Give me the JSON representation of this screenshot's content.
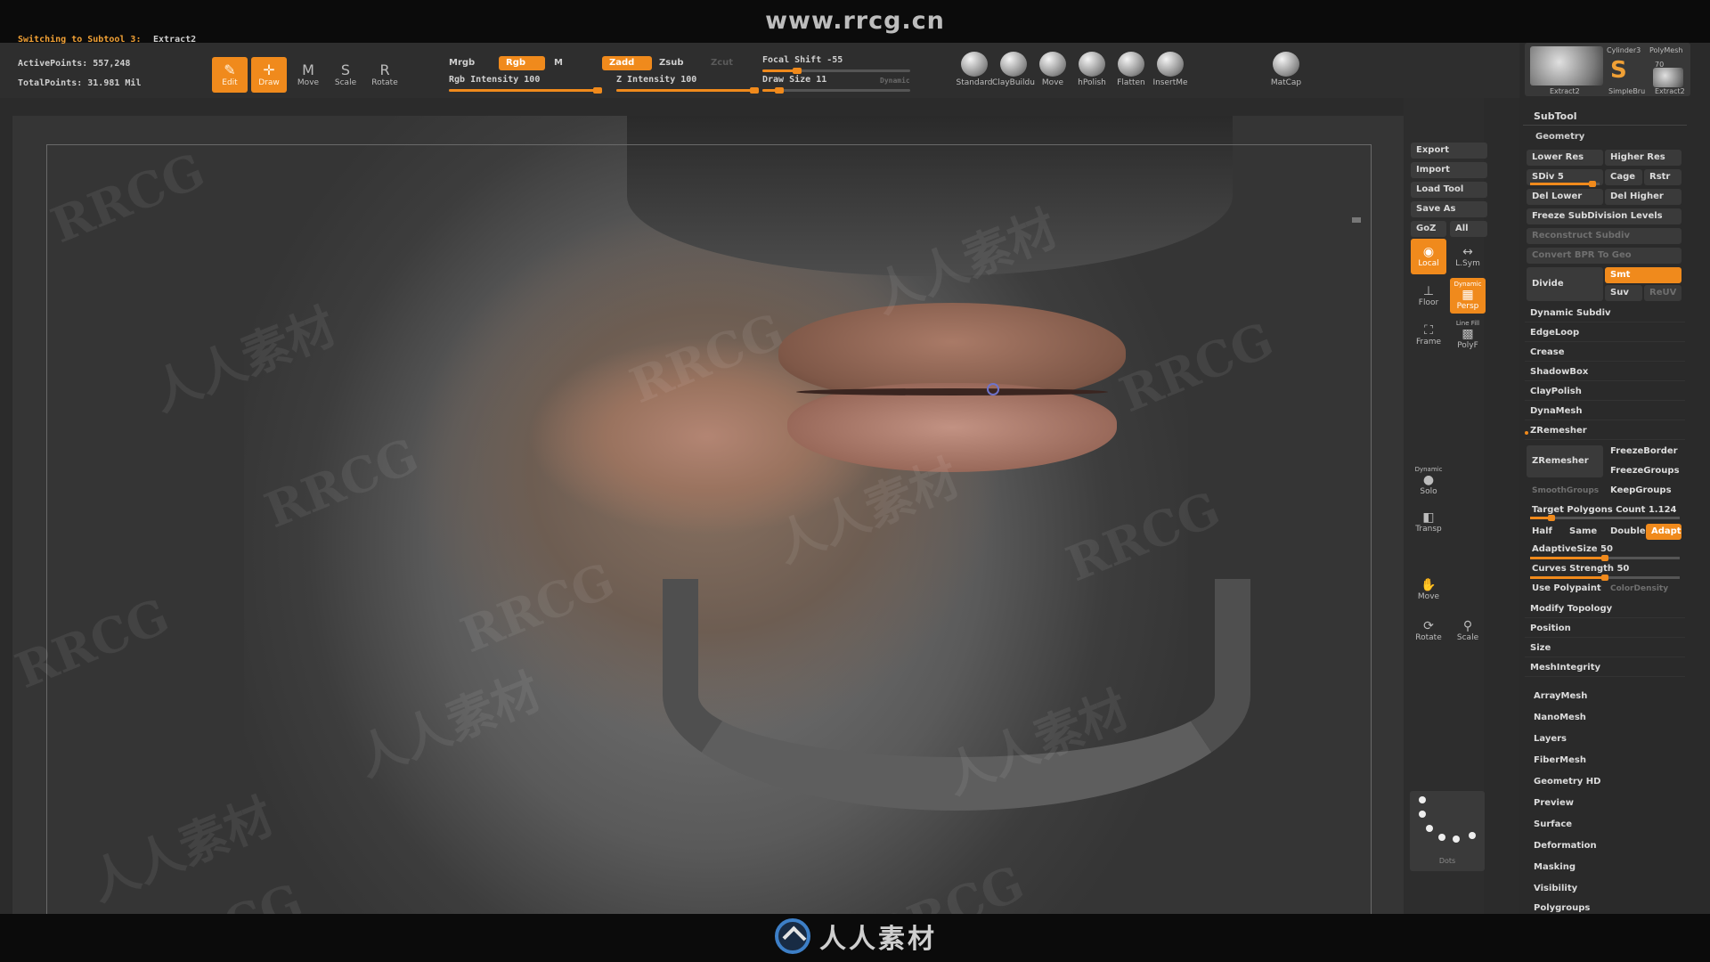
{
  "site": {
    "url": "www.rrcg.cn",
    "bottom_brand": "人人素材"
  },
  "status": {
    "switching_label": "Switching to Subtool 3:",
    "switching_value": "Extract2",
    "active_points": "ActivePoints: 557,248",
    "total_points": "TotalPoints: 31.981 Mil"
  },
  "toolbar": {
    "modes": [
      {
        "label": "Edit",
        "active": true
      },
      {
        "label": "Draw",
        "active": true
      },
      {
        "label": "Move",
        "active": false
      },
      {
        "label": "Scale",
        "active": false
      },
      {
        "label": "Rotate",
        "active": false
      }
    ],
    "mrgb": "Mrgb",
    "rgb": "Rgb",
    "m": "M",
    "zadd": "Zadd",
    "zsub": "Zsub",
    "zcut": "Zcut",
    "rgb_intensity": {
      "label": "Rgb Intensity 100",
      "value": 100
    },
    "z_intensity": {
      "label": "Z Intensity 100",
      "value": 100
    },
    "focal_shift": {
      "label": "Focal Shift -55",
      "value": -55
    },
    "draw_size": {
      "label": "Draw Size 11",
      "value": 11
    },
    "dynamic": "Dynamic",
    "brushes": [
      "Standard",
      "ClayBuildu",
      "Move",
      "hPolish",
      "Flatten",
      "InsertMe",
      "MatCap"
    ]
  },
  "shelf": {
    "buttons": [
      "Export",
      "Import",
      "Load Tool",
      "Save As"
    ],
    "goz": "GoZ",
    "all": "All",
    "tools": [
      "Local",
      "L.Sym",
      "Floor",
      "Persp",
      "Frame",
      "PolyF",
      "Solo",
      "Transp",
      "Move",
      "Rotate",
      "Scale"
    ],
    "dynamic_label": "Dynamic",
    "line_fill": "Line Fill",
    "dots": "Dots"
  },
  "palette": {
    "thumbs": [
      "Cylinder3",
      "PolyMesh",
      "Extract2",
      "SimpleBru",
      "Extract2"
    ],
    "thumb_count": "70",
    "subtool": "SubTool",
    "geometry": "Geometry",
    "lower_res": "Lower Res",
    "higher_res": "Higher Res",
    "sdiv": "SDiv 5",
    "cage": "Cage",
    "rstr": "Rstr",
    "del_lower": "Del Lower",
    "del_higher": "Del Higher",
    "freeze_subdiv": "Freeze SubDivision Levels",
    "reconstruct": "Reconstruct Subdiv",
    "convert_bpr": "Convert BPR To Geo",
    "divide": "Divide",
    "smt": "Smt",
    "suv": "Suv",
    "reuv": "ReUV",
    "rows1": [
      "Dynamic Subdiv",
      "EdgeLoop",
      "Crease",
      "ShadowBox",
      "ClayPolish",
      "DynaMesh"
    ],
    "zremesher_header": "ZRemesher",
    "zremesher_btn": "ZRemesher",
    "freeze_border": "FreezeBorder",
    "freeze_groups": "FreezeGroups",
    "smooth_groups": "SmoothGroups",
    "keep_groups": "KeepGroups",
    "target_poly": "Target Polygons Count 1.124",
    "half": "Half",
    "same": "Same",
    "double": "Double",
    "adapt": "Adapt",
    "adaptive_size": {
      "label": "AdaptiveSize 50",
      "value": 50
    },
    "curves_strength": {
      "label": "Curves Strength 50",
      "value": 50
    },
    "use_polypaint": "Use Polypaint",
    "color_density": "ColorDensity",
    "rows2": [
      "Modify Topology",
      "Position",
      "Size",
      "MeshIntegrity"
    ],
    "sections": [
      "ArrayMesh",
      "NanoMesh",
      "Layers",
      "FiberMesh",
      "Geometry HD",
      "Preview",
      "Surface",
      "Deformation",
      "Masking",
      "Visibility",
      "Polygroups"
    ]
  },
  "watermarks": [
    "RRCG",
    "人人素材"
  ],
  "colors": {
    "accent": "#f08a1c",
    "bg": "#2b2b2b",
    "viewport": "#353535"
  }
}
